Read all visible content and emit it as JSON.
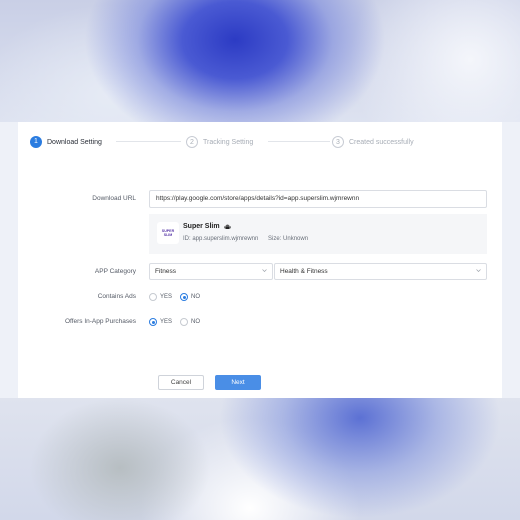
{
  "stepper": {
    "steps": [
      {
        "number": "1",
        "label": "Download Setting"
      },
      {
        "number": "2",
        "label": "Tracking Setting"
      },
      {
        "number": "3",
        "label": "Created successfully"
      }
    ]
  },
  "form": {
    "download_url": {
      "label": "Download URL",
      "value": "https://play.google.com/store/apps/details?id=app.superslim.wjmrewnn"
    },
    "app": {
      "icon_text_line1": "SUPER",
      "icon_text_line2": "SLIM",
      "name": "Super Slim",
      "platform_icon": "android-icon",
      "id_text": "ID: app.superslim.wjmrewnn",
      "size_text": "Size: Unknown"
    },
    "app_category": {
      "label": "APP Category",
      "primary": "Fitness",
      "secondary": "Health & Fitness"
    },
    "contains_ads": {
      "label": "Contains Ads",
      "options": [
        "YES",
        "NO"
      ],
      "selected": "NO"
    },
    "in_app_purchases": {
      "label": "Offers In-App Purchases",
      "options": [
        "YES",
        "NO"
      ],
      "selected": "YES"
    }
  },
  "actions": {
    "cancel_label": "Cancel",
    "next_label": "Next"
  },
  "colors": {
    "accent": "#2b7ce0",
    "next_button": "#4a8ee6"
  }
}
